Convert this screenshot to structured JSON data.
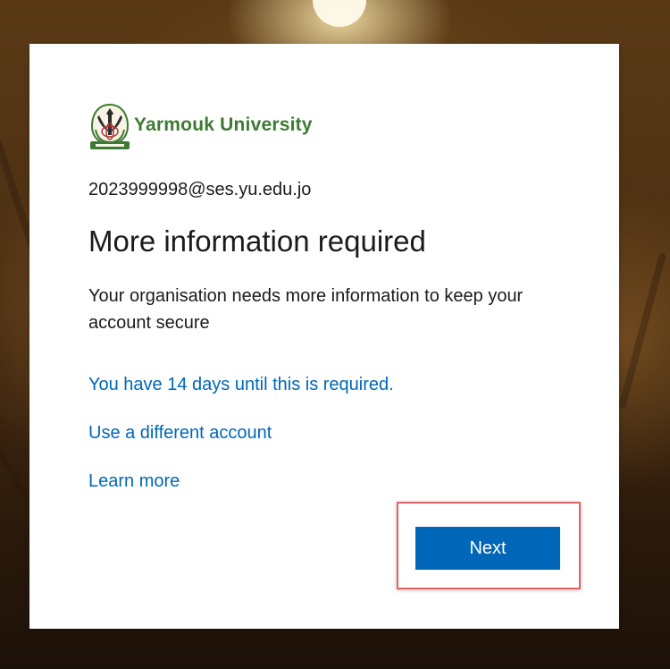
{
  "logo": {
    "text": "Yarmouk University",
    "seal_caption": "جامعة اليرموك",
    "brand_color": "#3e7a33"
  },
  "account": {
    "email": "2023999998@ses.yu.edu.jo"
  },
  "main": {
    "title": "More information required",
    "description": "Your organisation needs more information to keep your account secure"
  },
  "links": {
    "days_remaining": "You have 14 days until this is required.",
    "different_account": "Use a different account",
    "learn_more": "Learn more"
  },
  "actions": {
    "next_label": "Next"
  },
  "colors": {
    "accent": "#0067b8",
    "highlight_border": "#e06468",
    "text": "#1b1b1b"
  }
}
